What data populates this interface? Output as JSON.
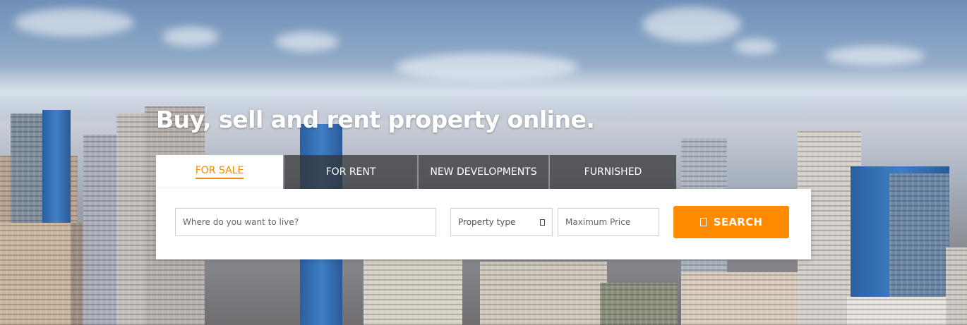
{
  "hero": {
    "headline": "Buy, sell and rent property online."
  },
  "tabs": [
    {
      "label": "FOR SALE",
      "active": true
    },
    {
      "label": "FOR RENT",
      "active": false
    },
    {
      "label": "NEW DEVELOPMENTS",
      "active": false
    },
    {
      "label": "FURNISHED",
      "active": false
    }
  ],
  "search": {
    "location_placeholder": "Where do you want to live?",
    "property_type_value": "Property type",
    "max_price_placeholder": "Maximum Price",
    "button_label": "SEARCH"
  },
  "colors": {
    "accent": "#ff8a00",
    "active_tab_text": "#f28b00",
    "tab_bg": "#323232"
  }
}
